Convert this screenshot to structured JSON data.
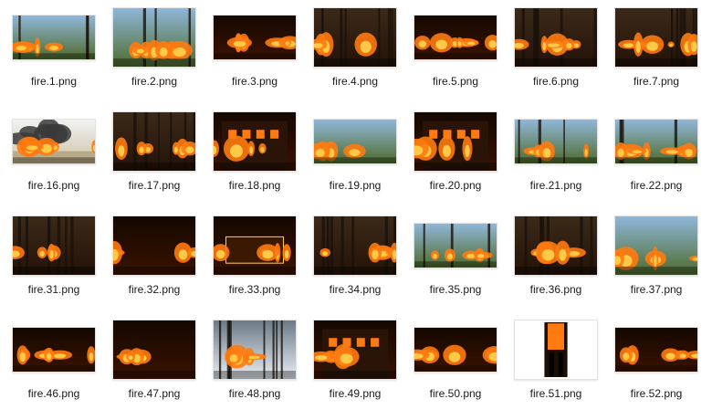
{
  "view": {
    "items": [
      {
        "name": "fire.1.png",
        "scene": "field",
        "aspect": "wide"
      },
      {
        "name": "fire.2.png",
        "scene": "field",
        "aspect": "tall"
      },
      {
        "name": "fire.3.png",
        "scene": "night",
        "aspect": "wide"
      },
      {
        "name": "fire.4.png",
        "scene": "forest",
        "aspect": "tall"
      },
      {
        "name": "fire.5.png",
        "scene": "night",
        "aspect": "wide"
      },
      {
        "name": "fire.6.png",
        "scene": "forest",
        "aspect": "tall"
      },
      {
        "name": "fire.7.png",
        "scene": "forest",
        "aspect": "tall"
      },
      {
        "name": "fire.16.png",
        "scene": "smoke",
        "aspect": "wide"
      },
      {
        "name": "fire.17.png",
        "scene": "forest",
        "aspect": "tall"
      },
      {
        "name": "fire.18.png",
        "scene": "building",
        "aspect": "tall"
      },
      {
        "name": "fire.19.png",
        "scene": "aerial",
        "aspect": "wide"
      },
      {
        "name": "fire.20.png",
        "scene": "building",
        "aspect": "tall"
      },
      {
        "name": "fire.21.png",
        "scene": "field",
        "aspect": "wide"
      },
      {
        "name": "fire.22.png",
        "scene": "field",
        "aspect": "wide"
      },
      {
        "name": "fire.31.png",
        "scene": "forest",
        "aspect": "tall"
      },
      {
        "name": "fire.32.png",
        "scene": "night",
        "aspect": "tall"
      },
      {
        "name": "fire.33.png",
        "scene": "vehicle",
        "aspect": "tall"
      },
      {
        "name": "fire.34.png",
        "scene": "forest",
        "aspect": "tall"
      },
      {
        "name": "fire.35.png",
        "scene": "field",
        "aspect": "wide"
      },
      {
        "name": "fire.36.png",
        "scene": "forest",
        "aspect": "tall"
      },
      {
        "name": "fire.37.png",
        "scene": "aerial",
        "aspect": "tall"
      },
      {
        "name": "fire.46.png",
        "scene": "night",
        "aspect": "wide"
      },
      {
        "name": "fire.47.png",
        "scene": "night",
        "aspect": "tall"
      },
      {
        "name": "fire.48.png",
        "scene": "snow",
        "aspect": "tall"
      },
      {
        "name": "fire.49.png",
        "scene": "building",
        "aspect": "tall"
      },
      {
        "name": "fire.50.png",
        "scene": "night",
        "aspect": "wide"
      },
      {
        "name": "fire.51.png",
        "scene": "doorway",
        "aspect": "tall"
      },
      {
        "name": "fire.52.png",
        "scene": "night",
        "aspect": "wide"
      }
    ]
  },
  "colors": {
    "flame": "#ff7a10",
    "ember": "#ffce4a",
    "night": "#140800",
    "smoke": "#3a3a3a",
    "vegetation": "#4f6b2c",
    "sky": "#8fb7d9",
    "snow": "#e9eef3"
  }
}
